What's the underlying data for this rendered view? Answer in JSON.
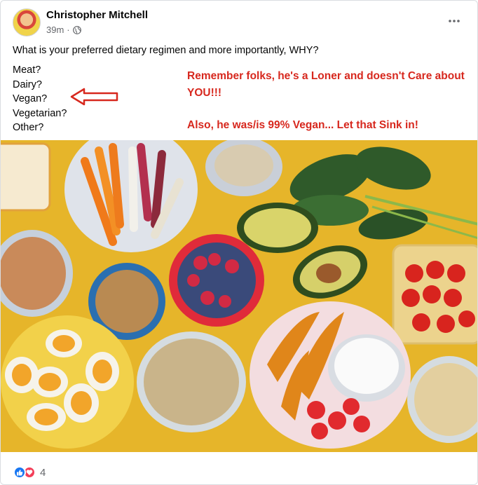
{
  "post": {
    "author": "Christopher Mitchell",
    "time": "39m",
    "separator": "·",
    "question": "What is your preferred dietary regimen and more importantly, WHY?",
    "options": [
      "Meat?",
      "Dairy?",
      "Vegan?",
      "Vegetarian?",
      "Other?"
    ],
    "annotation_1": "Remember folks, he's a Loner and doesn't Care about YOU!!!",
    "annotation_2": "Also, he was/is 99% Vegan... Let that Sink in!",
    "reaction_count": "4"
  },
  "icons": {
    "privacy": "globe-icon",
    "more": "more-options-icon",
    "reactions": [
      "like-icon",
      "love-icon"
    ]
  },
  "colors": {
    "annotation_red": "#d7281e",
    "like_blue": "#1877f2",
    "love_red": "#f33e58",
    "background_yellow": "#e8b82a"
  }
}
